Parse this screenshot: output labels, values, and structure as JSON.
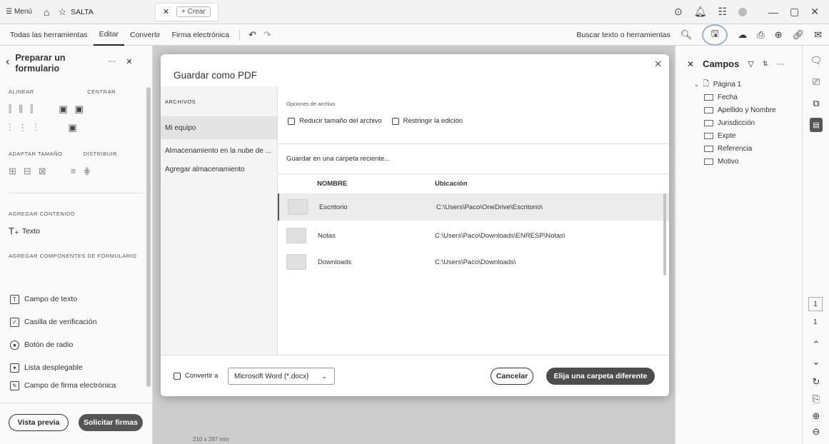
{
  "titlebar": {
    "menu_label": "Menú",
    "tab_title": "SALTA",
    "new_tab_label": "+ Crear"
  },
  "toolbar": {
    "items": [
      "Todas las herramientas",
      "Editar",
      "Convertir",
      "Firma electrónica"
    ],
    "find_placeholder": "Buscar texto o herramientas"
  },
  "left_panel": {
    "title": "Preparar un formulario",
    "sections": {
      "align": "ALINEAR",
      "center": "CENTRAR",
      "adapt": "ADAPTAR TAMAÑO",
      "distribute": "DISTRIBUIR",
      "add_content": "AGREGAR CONTENIDO",
      "add_components": "AGREGAR COMPONENTES DE FORMULARIO"
    },
    "text_tool": "Texto",
    "components": [
      "Campo de texto",
      "Casilla de verificación",
      "Botón de radio",
      "Lista desplegable",
      "Campo de firma electrónica"
    ],
    "preview_button": "Vista previa",
    "request_button": "Solicitar firmas"
  },
  "document": {
    "page_size": "210 x 297 mm"
  },
  "modal": {
    "title": "Guardar como PDF",
    "files_header": "ARCHIVOS",
    "locations": [
      "Mi equipo",
      "Almacenamiento en la nube de ...",
      "Agregar almacenamiento"
    ],
    "options_header": "Opciones de archivo",
    "reduce_size": "Reducir tamaño del archivo",
    "restrict_edit": "Restringir la edición",
    "recent_folder": "Guardar en una carpeta reciente...",
    "col_name": "NOMBRE",
    "col_location": "Ubicación",
    "folders": [
      {
        "name": "Escritorio",
        "path": "C:\\Users\\Paco\\OneDrive\\Escritorio\\"
      },
      {
        "name": "Notas",
        "path": "C:\\Users\\Paco\\Downloads\\ENRESP\\Notas\\"
      },
      {
        "name": "Downloads",
        "path": "C:\\Users\\Paco\\Downloads\\"
      }
    ],
    "convert_label": "Convertir a",
    "convert_value": "Microsoft Word (*.docx)",
    "cancel_label": "Cancelar",
    "choose_label": "Elija una carpeta diferente"
  },
  "right_panel": {
    "title": "Campos",
    "page_label": "Página 1",
    "fields": [
      "Fecha",
      "Apellido y Nombre",
      "Jurisdicción",
      "Expte",
      "Referencia",
      "Motivo"
    ]
  },
  "rail": {
    "page_current": "1",
    "page_total": "1"
  }
}
